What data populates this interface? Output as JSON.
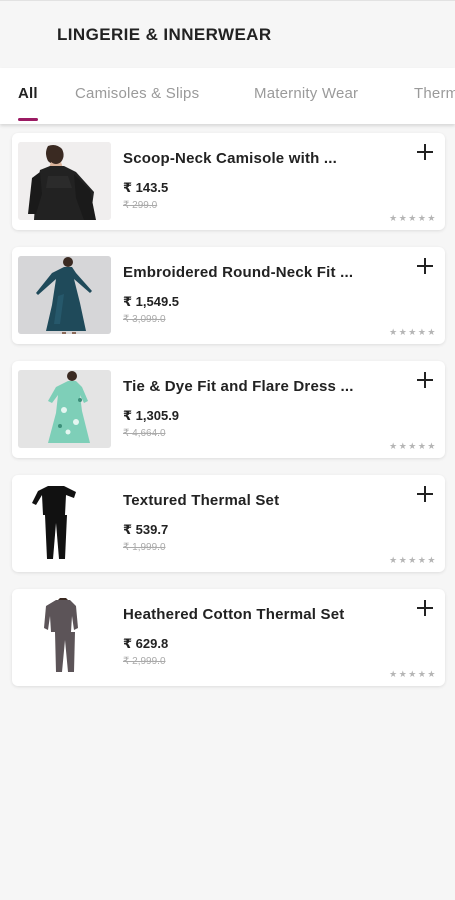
{
  "header": {
    "title": "LINGERIE & INNERWEAR"
  },
  "tabs": [
    {
      "label": "All"
    },
    {
      "label": "Camisoles & Slips"
    },
    {
      "label": "Maternity Wear"
    },
    {
      "label": "Therm"
    }
  ],
  "products": [
    {
      "name": "Scoop-Neck Camisole with ...",
      "price": "₹ 143.5",
      "mrp": "₹ 299.0",
      "stars": "★★★★★",
      "image_icon": "camisole-photo"
    },
    {
      "name": "Embroidered Round-Neck Fit ...",
      "price": "₹ 1,549.5",
      "mrp": "₹ 3,099.0",
      "stars": "★★★★★",
      "image_icon": "dress-photo"
    },
    {
      "name": "Tie & Dye Fit and Flare Dress ...",
      "price": "₹ 1,305.9",
      "mrp": "₹ 4,664.0",
      "stars": "★★★★★",
      "image_icon": "dress-photo"
    },
    {
      "name": "Textured Thermal Set",
      "price": "₹ 539.7",
      "mrp": "₹ 1,999.0",
      "stars": "★★★★★",
      "image_icon": "thermal-set-photo"
    },
    {
      "name": "Heathered Cotton Thermal Set",
      "price": "₹ 629.8",
      "mrp": "₹ 2,999.0",
      "stars": "★★★★★",
      "image_icon": "thermal-set-photo"
    }
  ],
  "colors": {
    "accent": "#9b1b63",
    "background": "#f6f6f6"
  }
}
